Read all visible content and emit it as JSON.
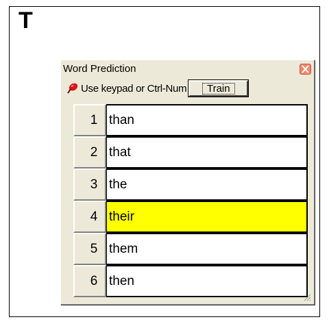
{
  "document": {
    "typed_char": "T"
  },
  "window": {
    "title": "Word Prediction",
    "hint": "Use keypad or Ctrl-Num",
    "train_label": "Train"
  },
  "predictions": [
    {
      "number": "1",
      "word": "than",
      "selected": false
    },
    {
      "number": "2",
      "word": "that",
      "selected": false
    },
    {
      "number": "3",
      "word": "the",
      "selected": false
    },
    {
      "number": "4",
      "word": "their",
      "selected": true
    },
    {
      "number": "5",
      "word": "them",
      "selected": false
    },
    {
      "number": "6",
      "word": "then",
      "selected": false
    }
  ],
  "colors": {
    "selected_highlight": "#ffff00",
    "window_bg": "#ece9d8",
    "close_button": "#f0876d"
  }
}
